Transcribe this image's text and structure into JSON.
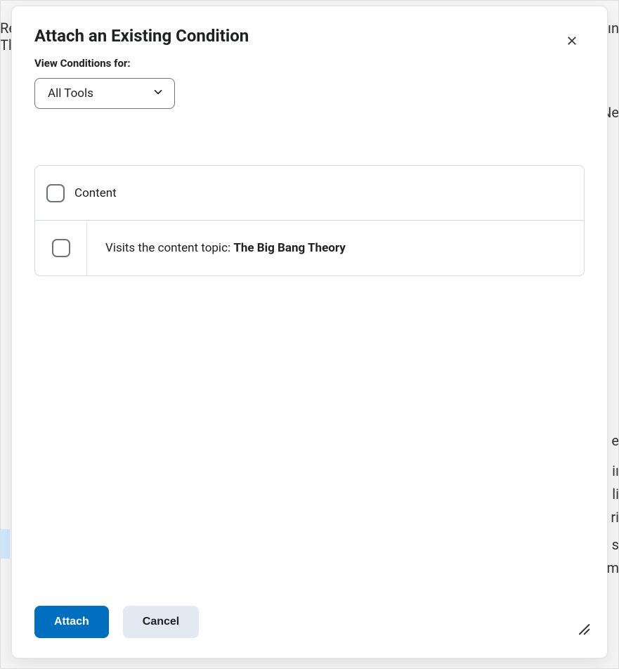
{
  "modal": {
    "title": "Attach an Existing Condition",
    "view_conditions_label": "View Conditions for:",
    "tool_select_value": "All Tools",
    "conditions": {
      "group_label": "Content",
      "items": [
        {
          "prefix": "Visits the content topic: ",
          "bold": "The Big Bang Theory"
        }
      ]
    },
    "buttons": {
      "attach": "Attach",
      "cancel": "Cancel"
    }
  },
  "background_text": {
    "j1": "Re",
    "j2": "Tl",
    "j3": "ın",
    "j4": "Ne",
    "j5": "e",
    "j6": "iı",
    "j7": "li",
    "j8": "ri",
    "j9": "s",
    "j10": "m"
  }
}
